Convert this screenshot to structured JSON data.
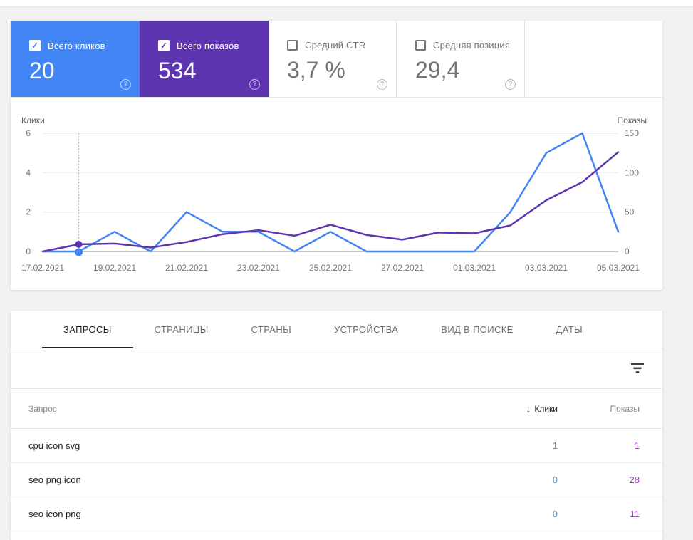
{
  "colors": {
    "clicks_blue": "#4285f4",
    "impressions_purple": "#5e35b1",
    "table_clicks_value": "#4a90f4",
    "table_impressions_value": "#9c42b4",
    "active_tab": "#202124"
  },
  "summary_cards": [
    {
      "id": "clicks",
      "label": "Всего кликов",
      "value": "20",
      "checked": true
    },
    {
      "id": "impressions",
      "label": "Всего показов",
      "value": "534",
      "checked": true
    },
    {
      "id": "ctr",
      "label": "Средний CTR",
      "value": "3,7 %",
      "checked": false
    },
    {
      "id": "position",
      "label": "Средняя позиция",
      "value": "29,4",
      "checked": false
    }
  ],
  "help_icon": "?",
  "chart": {
    "left_axis_label": "Клики",
    "right_axis_label": "Показы",
    "chart_data": {
      "type": "line",
      "x": [
        "17.02.2021",
        "18.02.2021",
        "19.02.2021",
        "20.02.2021",
        "21.02.2021",
        "22.02.2021",
        "23.02.2021",
        "24.02.2021",
        "25.02.2021",
        "26.02.2021",
        "27.02.2021",
        "28.02.2021",
        "01.03.2021",
        "02.03.2021",
        "03.03.2021",
        "04.03.2021",
        "05.03.2021"
      ],
      "x_tick_labels": [
        "17.02.2021",
        "19.02.2021",
        "21.02.2021",
        "23.02.2021",
        "25.02.2021",
        "27.02.2021",
        "01.03.2021",
        "03.03.2021",
        "05.03.2021"
      ],
      "series": [
        {
          "name": "Клики",
          "axis": "left",
          "color": "#4285f4",
          "values": [
            0,
            0,
            1,
            0,
            2,
            1,
            1,
            0,
            1,
            0,
            0,
            0,
            0,
            2,
            5,
            6,
            1
          ]
        },
        {
          "name": "Показы",
          "axis": "right",
          "color": "#5e35b1",
          "values": [
            0,
            9,
            10,
            5,
            12,
            22,
            27,
            20,
            34,
            21,
            15,
            24,
            23,
            33,
            65,
            88,
            126
          ]
        }
      ],
      "left_ylim": [
        0,
        6
      ],
      "right_ylim": [
        0,
        150
      ],
      "left_ticks": [
        0,
        2,
        4,
        6
      ],
      "right_ticks": [
        0,
        50,
        100,
        150
      ],
      "grid": true,
      "hover_index": 1
    }
  },
  "tabs": [
    {
      "label": "ЗАПРОСЫ",
      "active": true
    },
    {
      "label": "СТРАНИЦЫ",
      "active": false
    },
    {
      "label": "СТРАНЫ",
      "active": false
    },
    {
      "label": "УСТРОЙСТВА",
      "active": false
    },
    {
      "label": "ВИД В ПОИСКЕ",
      "active": false
    },
    {
      "label": "ДАТЫ",
      "active": false
    }
  ],
  "table": {
    "columns": {
      "query": "Запрос",
      "clicks": "Клики",
      "impressions": "Показы"
    },
    "sort_icon": "↓",
    "rows": [
      {
        "query": "cpu icon svg",
        "clicks": "1",
        "impressions": "1"
      },
      {
        "query": "seo png icon",
        "clicks": "0",
        "impressions": "28"
      },
      {
        "query": "seo icon png",
        "clicks": "0",
        "impressions": "11"
      }
    ]
  }
}
